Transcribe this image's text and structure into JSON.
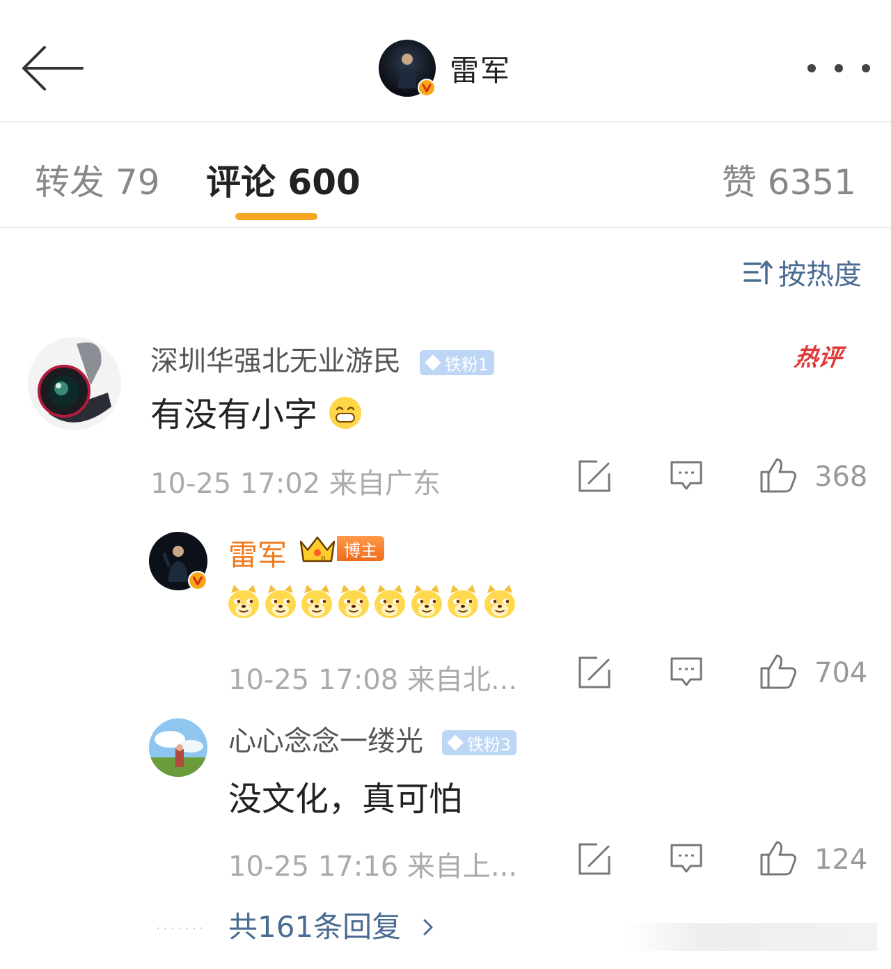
{
  "header": {
    "title": "雷军",
    "back_icon": "arrow-left-icon",
    "more_icon": "more-dots-icon",
    "verified_icon": "verified-v-icon"
  },
  "tabs": {
    "repost_label": "转发 79",
    "comment_label": "评论 600",
    "like_label": "赞 6351",
    "active": "comment",
    "accent": "#f5a623"
  },
  "sort": {
    "label": "按热度",
    "icon": "sort-icon"
  },
  "comments": [
    {
      "user": "深圳华强北无业游民",
      "badge": "铁粉1",
      "hot_tag": "热评",
      "text": "有没有小字",
      "emoji": "grin-emoji",
      "time": "10-25 17:02 来自广东",
      "likes": "368"
    }
  ],
  "replies": [
    {
      "user": "雷军",
      "badge": "博主",
      "crown_level": "II",
      "emoji_count": 8,
      "emoji": "doge-emoji",
      "time": "10-25 17:08 来自北...",
      "likes": "704"
    },
    {
      "user": "心心念念一缕光",
      "badge": "铁粉3",
      "text": "没文化，真可怕",
      "time": "10-25 17:16 来自上...",
      "likes": "124"
    }
  ],
  "more_replies": {
    "label": "共161条回复",
    "icon": "chevron-right-icon"
  },
  "colors": {
    "link": "#4a6b92",
    "host_name": "#f07a1c",
    "hot": "#e0393a",
    "badge_bg": "#bdd6f5"
  }
}
